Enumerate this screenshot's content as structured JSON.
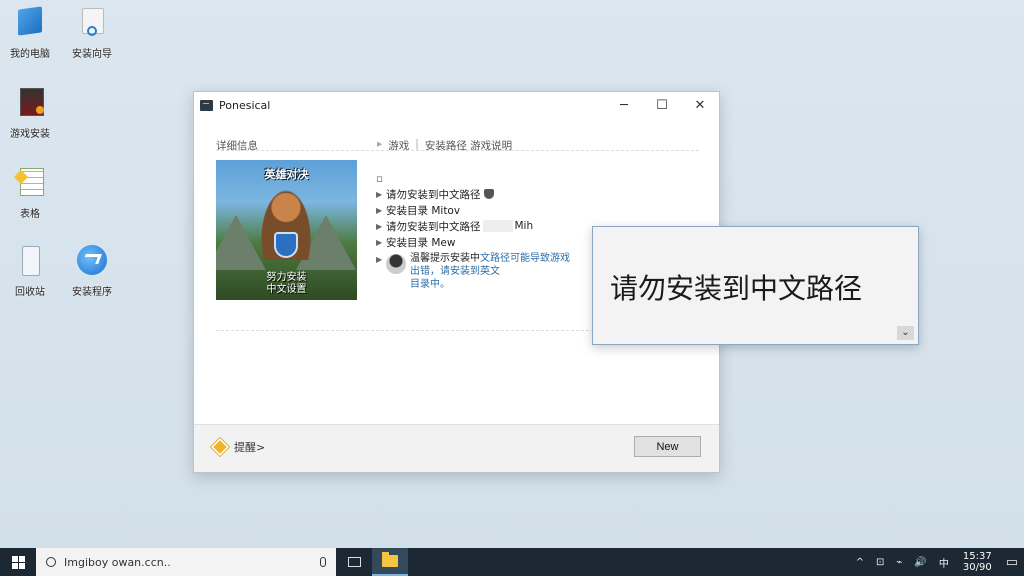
{
  "desktop": {
    "icons": [
      {
        "label": "我的电脑",
        "icon": "computer-icon"
      },
      {
        "label": "安装向导",
        "icon": "installer-icon"
      },
      {
        "label": "游戏安装",
        "icon": "game-installer-icon"
      },
      {
        "label": "表格",
        "icon": "spreadsheet-icon"
      },
      {
        "label": "回收站",
        "icon": "recycle-bin-icon"
      },
      {
        "label": "安装程序",
        "icon": "setup-icon"
      }
    ]
  },
  "window": {
    "title": "Ponesical",
    "controls": {
      "minimize": "─",
      "maximize": "☐",
      "close": "✕"
    },
    "breadcrumbs": [
      "详细信息",
      "游戏",
      "安装路径 游戏说明"
    ],
    "banner": {
      "title": "英雄对决",
      "subtitle_line1": "努力安装",
      "subtitle_line2": "中文设置"
    },
    "list_header": "▫",
    "list_items": [
      {
        "pre": "请勿安装到中文路径",
        "post": ""
      },
      {
        "pre": "安装目录 Mitov",
        "post": ""
      },
      {
        "pre": "请勿安装到中文路径",
        "post": "Mih"
      },
      {
        "pre": "安装目录 Mew",
        "post": ""
      }
    ],
    "note": {
      "line1_dark": "温馨提示安装中",
      "line1_blue": "文路径可能导致游戏",
      "line2": "出错，请安装到英文",
      "line3": "目录中。"
    },
    "footer_hint": "提醒>",
    "new_button": "New"
  },
  "popup": {
    "text": "请勿安装到中文路径",
    "chevron": "⌄"
  },
  "taskbar": {
    "search_text": "Imgiboy owan.ccn..",
    "tray_icons": [
      "^",
      "⊡",
      "⌁",
      "🔊",
      "中"
    ],
    "time": "15:37",
    "date": "30/90",
    "notification": "▭"
  }
}
